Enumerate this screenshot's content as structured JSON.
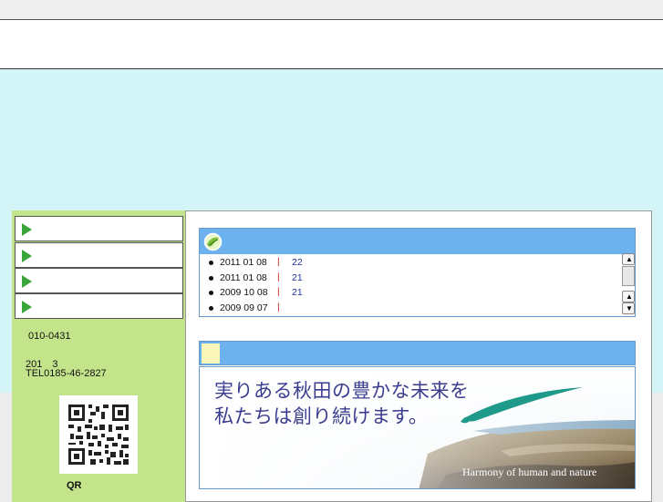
{
  "sidebar": {
    "nav_items": [
      "",
      "",
      "",
      ""
    ],
    "postal": "010-0431",
    "address_line": "201　3",
    "tel": "TEL0185-46-2827",
    "qr_label": "QR"
  },
  "news": {
    "items": [
      {
        "date": "2011 01 08",
        "sep": "|",
        "num": "22"
      },
      {
        "date": "2011 01 08",
        "sep": "|",
        "num": "21"
      },
      {
        "date": "2009 10 08",
        "sep": "|",
        "num": "21"
      },
      {
        "date": "2009 09 07",
        "sep": "|",
        "num": ""
      }
    ]
  },
  "banner": {
    "line1": "実りある秋田の豊かな未来を",
    "line2": "私たちは創り続けます。",
    "tagline": "Harmony of human and nature"
  },
  "colors": {
    "sidebar_bg": "#c4e48c",
    "hero_bg": "#d4f5f7",
    "panel_header": "#6cb2ee",
    "banner_text": "#3a3d8e"
  }
}
